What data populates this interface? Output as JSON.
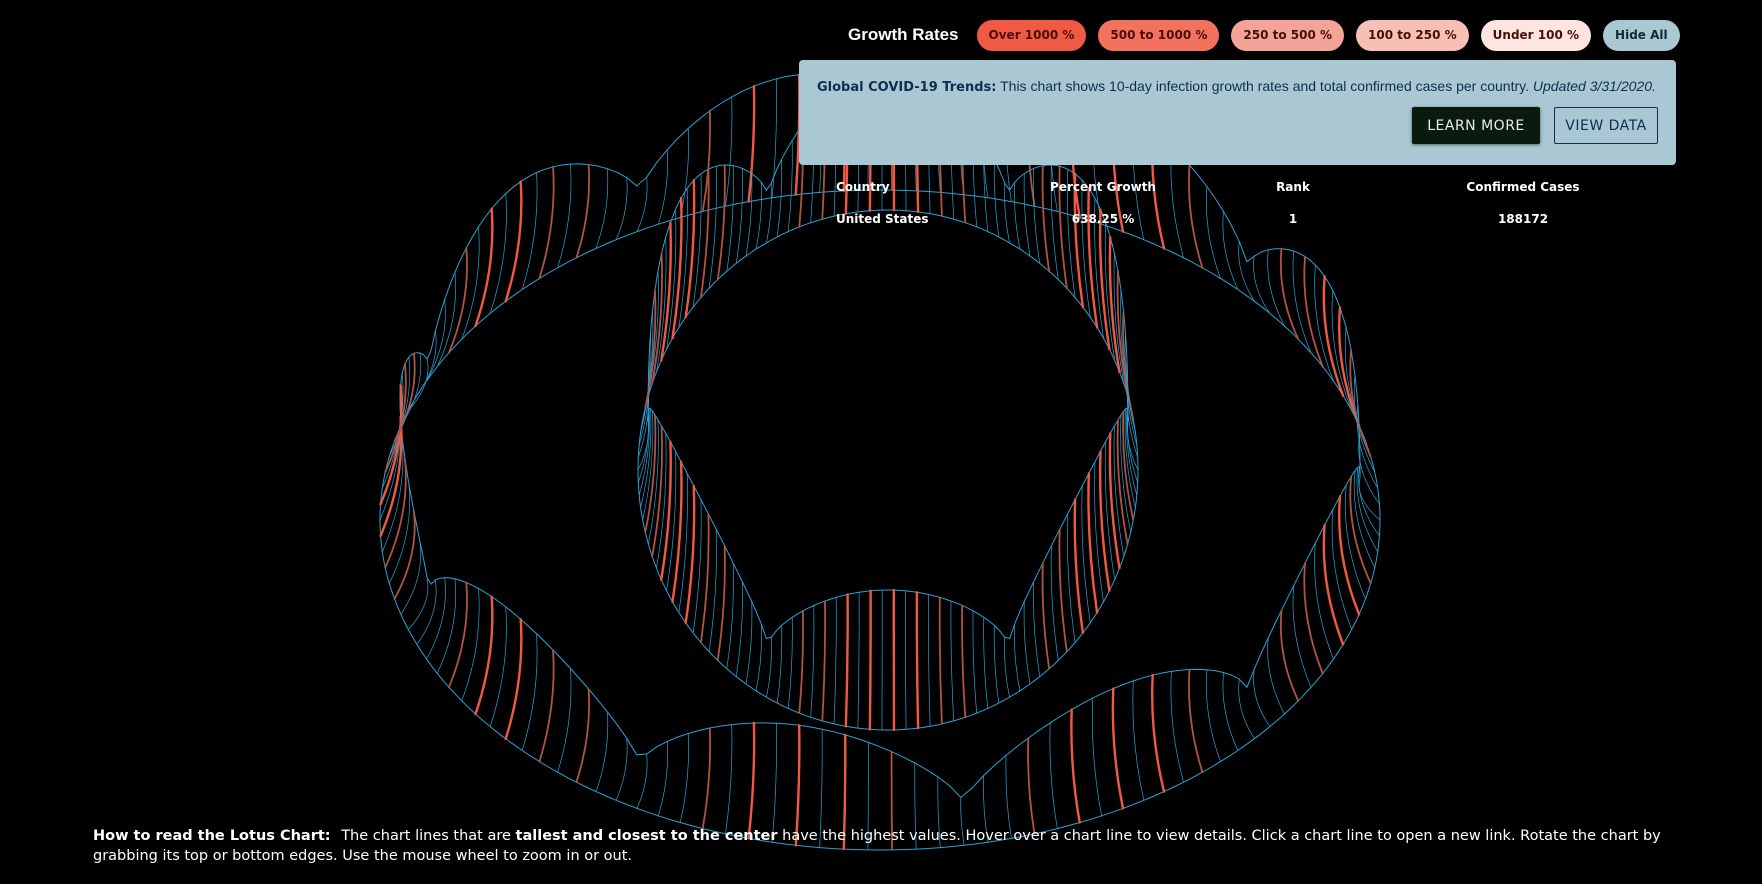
{
  "filters": {
    "title": "Growth Rates",
    "buttons": [
      {
        "label": "Over 1000 %",
        "color": "#f05a44"
      },
      {
        "label": "500 to 1000 %",
        "color": "#f2725f"
      },
      {
        "label": "250 to 500 %",
        "color": "#f3a498"
      },
      {
        "label": "100 to 250 %",
        "color": "#f6c0b7"
      },
      {
        "label": "Under 100 %",
        "color": "#fde6e1"
      },
      {
        "label": "Hide All",
        "color": "#a9c8d3"
      }
    ]
  },
  "info": {
    "heading": "Global COVID-19 Trends:",
    "text": "This chart shows 10-day infection growth rates and total confirmed cases per country.",
    "updated": "Updated 3/31/2020.",
    "learn_more": "LEARN MORE",
    "view_data": "VIEW DATA"
  },
  "table": {
    "headers": {
      "country": "Country",
      "growth": "Percent Growth",
      "rank": "Rank",
      "cases": "Confirmed Cases"
    },
    "row": {
      "country": "United States",
      "growth": "638.25 %",
      "rank": "1",
      "cases": "188172"
    }
  },
  "howto": {
    "lead": "How to read the Lotus Chart:",
    "p1": "The chart lines that are",
    "emph": "tallest and closest to the center",
    "p2": "have the highest values. Hover over a chart line to view details. Click a chart line to open a new link. Rotate the chart by grabbing its top or bottom edges. Use the mouse wheel to zoom in or out."
  },
  "colors": {
    "background": "#000000",
    "ring_stroke": "#2aa3d6",
    "line_high": "#f05a44",
    "line_low": "#b05444",
    "panel": "#a9c8d3"
  },
  "icons": []
}
